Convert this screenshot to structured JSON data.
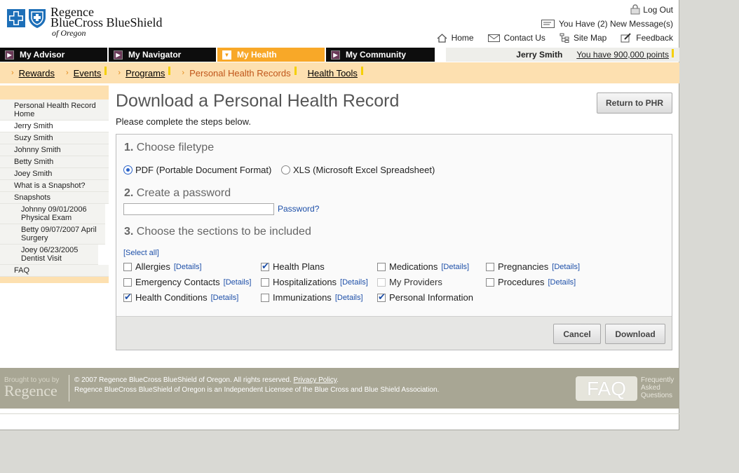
{
  "brand": {
    "line1": "Regence",
    "line2": "BlueCross BlueShield",
    "line3": "of Oregon",
    "accent_orange": "#f8a828",
    "accent_blue": "#1d6fb8"
  },
  "header": {
    "logout_label": "Log Out",
    "messages_label": "You Have (2) New Message(s)",
    "util_nav": [
      {
        "label": "Home",
        "icon": "home-icon"
      },
      {
        "label": "Contact Us",
        "icon": "envelope-icon"
      },
      {
        "label": "Site Map",
        "icon": "sitemap-icon"
      },
      {
        "label": "Feedback",
        "icon": "feedback-icon"
      }
    ]
  },
  "main_nav": {
    "tabs": [
      {
        "label": "My Advisor"
      },
      {
        "label": "My Navigator"
      },
      {
        "label": "My Health"
      },
      {
        "label": "My Community"
      }
    ],
    "user_name": "Jerry Smith",
    "points_label": "You have 900,000 points"
  },
  "sub_nav": {
    "items": [
      {
        "label": "Rewards"
      },
      {
        "label": "Events"
      },
      {
        "label": "Programs"
      },
      {
        "label": "Personal Health Records"
      },
      {
        "label": "Health Tools"
      }
    ]
  },
  "sidebar": {
    "items": [
      {
        "label": "Personal Health Record Home"
      },
      {
        "label": "Jerry Smith"
      },
      {
        "label": "Suzy Smith"
      },
      {
        "label": "Johnny Smith"
      },
      {
        "label": "Betty Smith"
      },
      {
        "label": "Joey Smith"
      },
      {
        "label": "What is a Snapshot?"
      },
      {
        "label": "Snapshots"
      },
      {
        "label": "Johnny 09/01/2006 Physical Exam"
      },
      {
        "label": "Betty 09/07/2007 April Surgery"
      },
      {
        "label": "Joey 06/23/2005 Dentist Visit"
      },
      {
        "label": "FAQ"
      }
    ]
  },
  "main": {
    "title": "Download a Personal Health Record",
    "subtitle": "Please complete the steps below.",
    "return_button": "Return to PHR",
    "step1": {
      "num": "1.",
      "label": "Choose filetype"
    },
    "filetype_options": [
      {
        "label": "PDF (Portable Document Format)",
        "selected": true
      },
      {
        "label": "XLS (Microsoft Excel Spreadsheet)",
        "selected": false
      }
    ],
    "step2": {
      "num": "2.",
      "label": "Create a password"
    },
    "password_value": "",
    "password_help": "Password?",
    "step3": {
      "num": "3.",
      "label": "Choose the sections to be included"
    },
    "select_all": "[Select all]",
    "details_label": "[Details]",
    "sections": {
      "allergies": {
        "label": "Allergies",
        "checked": false
      },
      "health_plans": {
        "label": "Health Plans",
        "checked": true
      },
      "medications": {
        "label": "Medications",
        "checked": false
      },
      "pregnancies": {
        "label": "Pregnancies",
        "checked": false
      },
      "emergency_contacts": {
        "label": "Emergency Contacts",
        "checked": false
      },
      "hospitalizations": {
        "label": "Hospitalizations",
        "checked": false
      },
      "my_providers": {
        "label": "My Providers",
        "checked": false
      },
      "procedures": {
        "label": "Procedures",
        "checked": false
      },
      "health_conditions": {
        "label": "Health Conditions",
        "checked": true
      },
      "immunizations": {
        "label": "Immunizations",
        "checked": false
      },
      "personal_information": {
        "label": "Personal Information",
        "checked": true
      }
    },
    "cancel_button": "Cancel",
    "download_button": "Download"
  },
  "footer": {
    "brought_by": "Brought to you by",
    "regence": "Regence",
    "copyright": "© 2007 Regence BlueCross BlueShield of Oregon. All rights reserved.",
    "privacy": "Privacy Policy",
    "period": ".",
    "licensee": "Regence BlueCross BlueShield of Oregon is an Independent Licensee of the Blue Cross and Blue Shield Association.",
    "faq_label": "FAQ",
    "faq_line1": "Frequently",
    "faq_line2": "Asked",
    "faq_line3": "Questions"
  }
}
